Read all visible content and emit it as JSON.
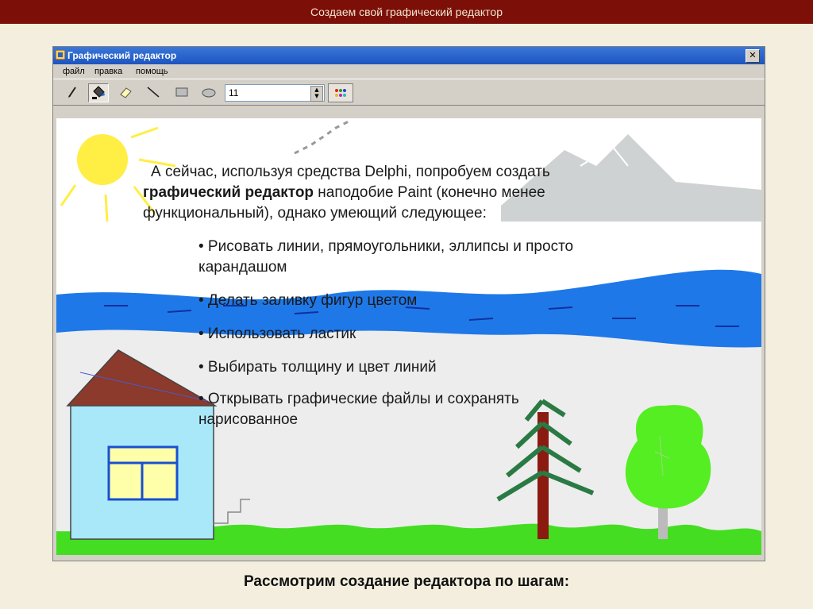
{
  "slide": {
    "title": "Создаем свой графический редактор",
    "caption": "Рассмотрим создание редактора по шагам:"
  },
  "window": {
    "title": "Графический редактор",
    "close_label": "✕",
    "menu": [
      "файл",
      "правка",
      "помощь"
    ],
    "toolbar": {
      "tools": [
        "pencil-icon",
        "fill-bucket-icon",
        "eraser-icon",
        "line-icon",
        "rectangle-icon",
        "ellipse-icon"
      ],
      "active_tool": "fill-bucket-icon",
      "line_width_value": "11",
      "color_button": "color-palette-icon"
    }
  },
  "overlay_text": {
    "para_start": "А сейчас, используя средства Delphi, попробуем создать ",
    "para_bold": "графический редактор",
    "para_end": " наподобие Paint (конечно менее функциональный), однако умеющий следующее:",
    "bullets": [
      "• Рисовать линии, прямоугольники, эллипсы и просто карандашом",
      "• Делать заливку фигур цветом",
      "• Использовать ластик",
      "• Выбирать толщину и цвет линий",
      "• Открывать графические файлы и сохранять нарисованное"
    ]
  },
  "colors": {
    "slide_bar": "#7c0f08",
    "sky": "#ffffff",
    "sun": "#ffee44",
    "river": "#1f78e8",
    "grass": "#44dd22",
    "house_wall": "#a8e8f8",
    "roof": "#8b3a2c",
    "window_fill": "#ffffaa",
    "tree_trunk": "#8b1a10",
    "fir": "#2a7a44",
    "bush": "#55ee22"
  }
}
